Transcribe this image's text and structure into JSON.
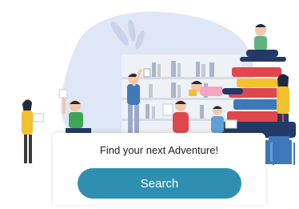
{
  "illustration": {
    "name": "library-adventure-illustration",
    "colors": {
      "blob": "#dfe6f6",
      "shelf": "#e5e9ef",
      "book_red": "#e0474c",
      "book_blue": "#3e78b8",
      "book_navy": "#233a66",
      "accent_yellow": "#f2c12e",
      "accent_green": "#5fb37e",
      "skin": "#f3c7a9",
      "hair": "#1f2b3d"
    }
  },
  "card": {
    "title": "Find your next Adventure!",
    "search_label": "Search",
    "button_color": "#2f8fb0"
  }
}
